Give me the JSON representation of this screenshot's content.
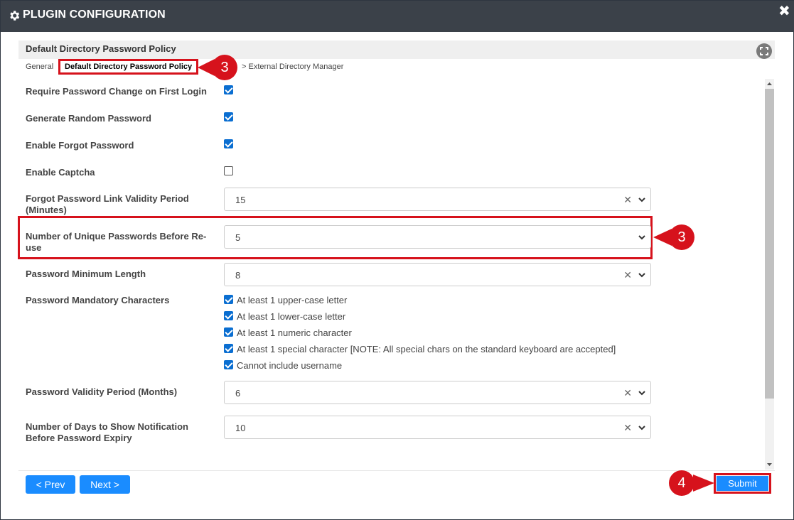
{
  "dialog": {
    "title": "PLUGIN CONFIGURATION",
    "close_symbol": "✖"
  },
  "section": {
    "title": "Default Directory Password Policy"
  },
  "breadcrumb": {
    "items": [
      "General",
      "Default Directory Password Policy",
      "> External Directory Manager"
    ],
    "active_index": 1
  },
  "callouts": {
    "breadcrumb": "3",
    "unique_passwords": "3",
    "submit": "4"
  },
  "form": {
    "require_password_change": {
      "label": "Require Password Change on First Login",
      "checked": true
    },
    "generate_random_password": {
      "label": "Generate Random Password",
      "checked": true
    },
    "enable_forgot_password": {
      "label": "Enable Forgot Password",
      "checked": true
    },
    "enable_captcha": {
      "label": "Enable Captcha",
      "checked": false
    },
    "forgot_link_validity": {
      "label_line1": "Forgot Password Link Validity Period",
      "label_line2": "(Minutes)",
      "value": "15"
    },
    "unique_passwords": {
      "label_line1": "Number of Unique Passwords Before Re-",
      "label_line2": "use",
      "value": "5"
    },
    "min_length": {
      "label": "Password Minimum Length",
      "value": "8"
    },
    "mandatory_chars": {
      "label": "Password Mandatory Characters",
      "options": [
        {
          "label": "At least 1 upper-case letter",
          "checked": true
        },
        {
          "label": "At least 1 lower-case letter",
          "checked": true
        },
        {
          "label": "At least 1 numeric character",
          "checked": true
        },
        {
          "label": "At least 1 special character [NOTE: All special chars on the standard keyboard are accepted]",
          "checked": true
        },
        {
          "label": "Cannot include username",
          "checked": true
        }
      ]
    },
    "validity_period": {
      "label": "Password Validity Period (Months)",
      "value": "6"
    },
    "notification_days": {
      "label_line1": "Number of Days to Show Notification",
      "label_line2": "Before Password Expiry",
      "value": "10"
    }
  },
  "select_clear_symbol": "✕",
  "buttons": {
    "prev": "< Prev",
    "next": "Next >",
    "submit": "Submit"
  },
  "colors": {
    "titlebar": "#3b4149",
    "accent_button": "#1a8cff",
    "highlight": "#d6121c",
    "checkbox": "#0a6ed1"
  },
  "icons": {
    "title": "gear-icon",
    "close": "close-icon",
    "expand": "expand-icon",
    "select_clear": "clear-icon",
    "select_arrow": "chevron-down-icon"
  }
}
